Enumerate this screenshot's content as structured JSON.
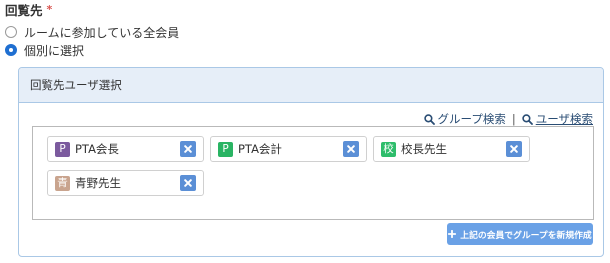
{
  "field": {
    "label": "回覧先",
    "required_mark": "*"
  },
  "options": [
    {
      "label": "ルームに参加している全会員",
      "checked": false
    },
    {
      "label": "個別に選択",
      "checked": true
    }
  ],
  "panel": {
    "title": "回覧先ユーザ選択",
    "group_search_label": "グループ検索",
    "separator": "|",
    "user_search_label": "ユーザ検索",
    "create_group_label": "上記の会員でグループを新規作成"
  },
  "selected_users": [
    {
      "initial": "P",
      "name": "PTA会長",
      "color": "#7b5a9e"
    },
    {
      "initial": "P",
      "name": "PTA会計",
      "color": "#29b463"
    },
    {
      "initial": "校",
      "name": "校長先生",
      "color": "#2ebd6b"
    },
    {
      "initial": "青",
      "name": "青野先生",
      "color": "#c9a48e"
    }
  ],
  "colors": {
    "accent": "#1f6fd1",
    "remove_button": "#5b8fd6",
    "create_button": "#6aa1e6",
    "panel_header": "#e6eef8",
    "panel_border": "#aac8e6",
    "link": "#2a4d74"
  },
  "icons": {
    "search": "search-icon",
    "remove": "close-icon",
    "add": "plus-icon"
  }
}
